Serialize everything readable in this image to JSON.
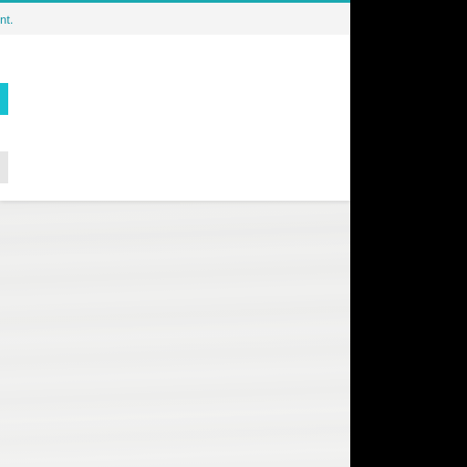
{
  "theme": {
    "accent": "#1aa8b0",
    "button_primary": "#16c1d1",
    "notice_text": "#1795a6"
  },
  "notice": {
    "text": "nt."
  },
  "buttons": {
    "primary_label": "",
    "secondary_label": ""
  }
}
